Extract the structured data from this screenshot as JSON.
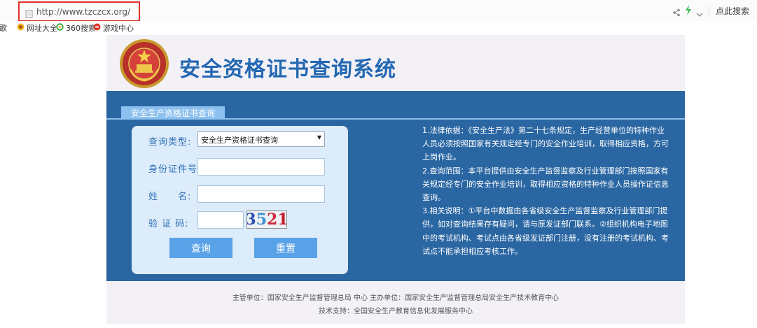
{
  "browser": {
    "url": "http://www.tzczcx.org/",
    "search_label": "点此搜索",
    "bookmarks": [
      {
        "label": "谷歌",
        "icon": "none"
      },
      {
        "label": "网址大全",
        "icon": "sunflower-icon"
      },
      {
        "label": "360搜索",
        "icon": "360-icon"
      },
      {
        "label": "游戏中心",
        "icon": "gamepad-icon"
      }
    ]
  },
  "site": {
    "title": "安全资格证书查询系统"
  },
  "tab": {
    "label": "安全生产资格证书查询"
  },
  "form": {
    "type_label": "查询类型:",
    "type_value": "安全生产资格证书查询",
    "id_label": "身份证件号:",
    "name_label": "姓　　名:",
    "captcha_label": "验 证 码:",
    "captcha_digits": [
      "3",
      "5",
      "2",
      "1"
    ],
    "query_button": "查询",
    "reset_button": "重置"
  },
  "notes": {
    "item1": "1.法律依据：《安全生产法》第二十七条规定，生产经营单位的特种作业人员必须按照国家有关规定经专门的安全作业培训，取得相应资格，方可上岗作业。",
    "item2": "2.查询范围：本平台提供由安全生产监督监察及行业管理部门按照国家有关规定经专门的安全作业培训，取得相应资格的特种作业人员操作证信息查询。",
    "item3": "3.相关说明：①平台中数据由各省级安全生产监督监察及行业管理部门提供，如对查询结果存有疑问，请与原发证部门联系。②组织机构电子地图中的考试机构、考试点由各省级发证部门注册，没有注册的考试机构、考试点不能承担相应考核工作。"
  },
  "footer": {
    "line1": "主管单位：国家安全生产监督管理总局 中心 主办单位：国家安全生产监督管理总局安全生产技术教育中心",
    "line2": "技术支持：全国安全生产教育信息化发展服务中心"
  },
  "colors": {
    "brand_blue": "#2468b2",
    "panel_blue": "#2a66a2",
    "button_blue": "#5aa2e8",
    "highlight_red": "#e0312a"
  }
}
